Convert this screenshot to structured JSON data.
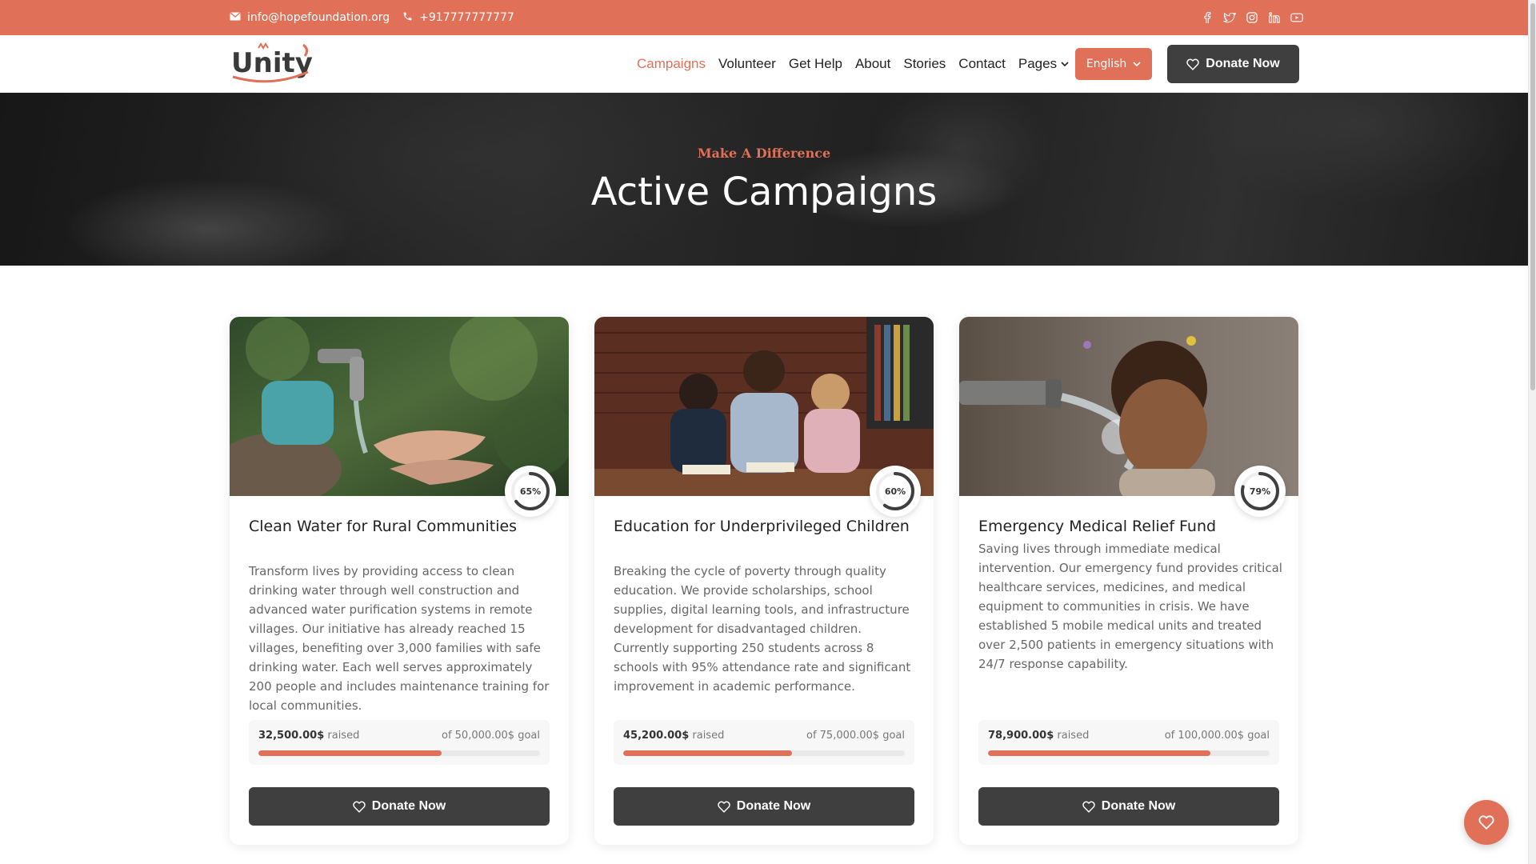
{
  "topbar": {
    "email": "info@hopefoundation.org",
    "phone": "+917777777777",
    "socials": [
      "facebook-icon",
      "twitter-icon",
      "instagram-icon",
      "linkedin-icon",
      "youtube-icon"
    ]
  },
  "header": {
    "logo_text": "Unity",
    "nav": [
      {
        "label": "Campaigns",
        "active": true
      },
      {
        "label": "Volunteer"
      },
      {
        "label": "Get Help"
      },
      {
        "label": "About"
      },
      {
        "label": "Stories"
      },
      {
        "label": "Contact"
      },
      {
        "label": "Pages",
        "dropdown": true
      }
    ],
    "language": "English",
    "donate_label": "Donate Now"
  },
  "hero": {
    "subtitle": "Make A Difference",
    "title": "Active Campaigns"
  },
  "campaigns": [
    {
      "title": "Clean Water for Rural Communities",
      "description": "Transform lives by providing access to clean drinking water through well construction and advanced water purification systems in remote villages. Our initiative has already reached 15 villages, benefiting over 3,000 families with safe drinking water. Each well serves approximately 200 people and includes maintenance training for local communities.",
      "percent": 65,
      "percent_label": "65%",
      "raised": "32,500.00$",
      "raised_suffix": " raised",
      "goal": "of 50,000.00$ goal",
      "donate_label": "Donate Now"
    },
    {
      "title": "Education for Underprivileged Children",
      "description": "Breaking the cycle of poverty through quality education. We provide scholarships, school supplies, digital learning tools, and infrastructure development for disadvantaged children. Currently supporting 250 students across 8 schools with 95% attendance rate and significant improvement in academic performance.",
      "percent": 60,
      "percent_label": "60%",
      "raised": "45,200.00$",
      "raised_suffix": " raised",
      "goal": "of 75,000.00$ goal",
      "donate_label": "Donate Now"
    },
    {
      "title": "Emergency Medical Relief Fund",
      "description": "Saving lives through immediate medical intervention. Our emergency fund provides critical healthcare services, medicines, and medical equipment to communities in crisis. We have established 5 mobile medical units and treated over 2,500 patients in emergency situations with 24/7 response capability.",
      "percent": 79,
      "percent_label": "79%",
      "raised": "78,900.00$",
      "raised_suffix": " raised",
      "goal": "of 100,000.00$ goal",
      "donate_label": "Donate Now"
    }
  ],
  "colors": {
    "accent": "#e07058",
    "dark_button": "#3f3f3f"
  }
}
